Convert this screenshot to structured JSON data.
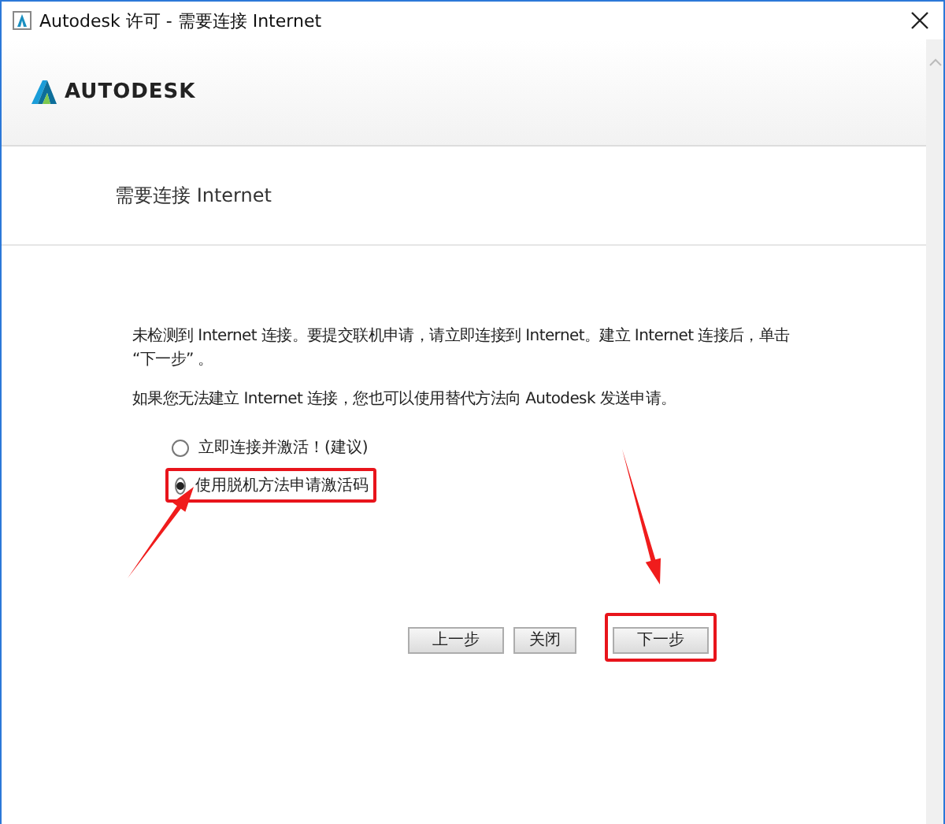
{
  "window": {
    "title": "Autodesk 许可 - 需要连接 Internet"
  },
  "logo": {
    "text": "AUTODESK"
  },
  "heading": "需要连接 Internet",
  "paragraphs": [
    "未检测到 Internet 连接。要提交联机申请，请立即连接到 Internet。建立 Internet 连接后，单击 “下一步” 。",
    "如果您无法建立 Internet 连接，您也可以使用替代方法向 Autodesk 发送申请。"
  ],
  "options": [
    {
      "label": "立即连接并激活！(建议)",
      "selected": false,
      "highlighted": false
    },
    {
      "label": "使用脱机方法申请激活码",
      "selected": true,
      "highlighted": true
    }
  ],
  "buttons": [
    {
      "label": "上一步",
      "highlighted": false
    },
    {
      "label": "关闭",
      "highlighted": false
    },
    {
      "label": "下一步",
      "highlighted": true
    }
  ]
}
